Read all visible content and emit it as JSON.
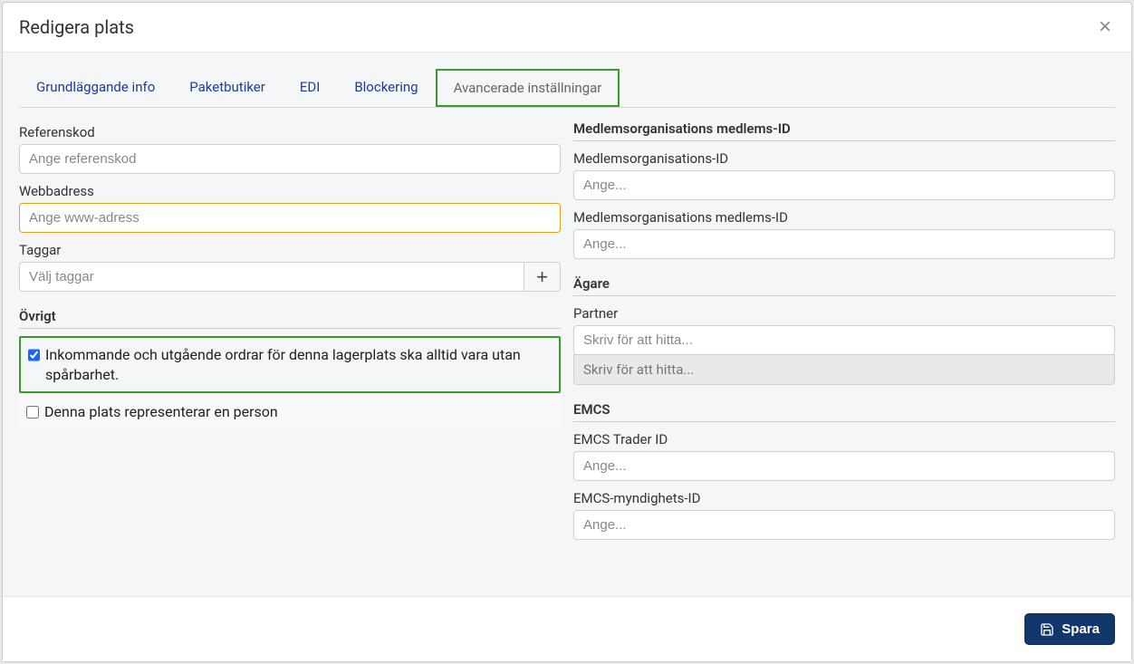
{
  "modal": {
    "title": "Redigera plats",
    "close_label": "×"
  },
  "tabs": {
    "items": [
      {
        "label": "Grundläggande info"
      },
      {
        "label": "Paketbutiker"
      },
      {
        "label": "EDI"
      },
      {
        "label": "Blockering"
      },
      {
        "label": "Avancerade inställningar",
        "active": true
      }
    ]
  },
  "left": {
    "reference_label": "Referenskod",
    "reference_placeholder": "Ange referenskod",
    "web_label": "Webbadress",
    "web_placeholder": "Ange www-adress",
    "tags_label": "Taggar",
    "tags_placeholder": "Välj taggar",
    "tags_add_label": "+",
    "other_header": "Övrigt",
    "check1_label": "Inkommande och utgående ordrar för denna lagerplats ska alltid vara utan spårbarhet.",
    "check2_label": "Denna plats representerar en person"
  },
  "right": {
    "memberorg_header": "Medlemsorganisations medlems-ID",
    "memberorg_id_label": "Medlemsorganisations-ID",
    "memberorg_id_placeholder": "Ange...",
    "memberorg_member_id_label": "Medlemsorganisations medlems-ID",
    "memberorg_member_id_placeholder": "Ange...",
    "owner_header": "Ägare",
    "partner_label": "Partner",
    "partner_placeholder": "Skriv för att hitta...",
    "partner_disabled_placeholder": "Skriv för att hitta...",
    "emcs_header": "EMCS",
    "emcs_trader_label": "EMCS Trader ID",
    "emcs_trader_placeholder": "Ange...",
    "emcs_authority_label": "EMCS-myndighets-ID",
    "emcs_authority_placeholder": "Ange..."
  },
  "footer": {
    "save_label": "Spara"
  }
}
